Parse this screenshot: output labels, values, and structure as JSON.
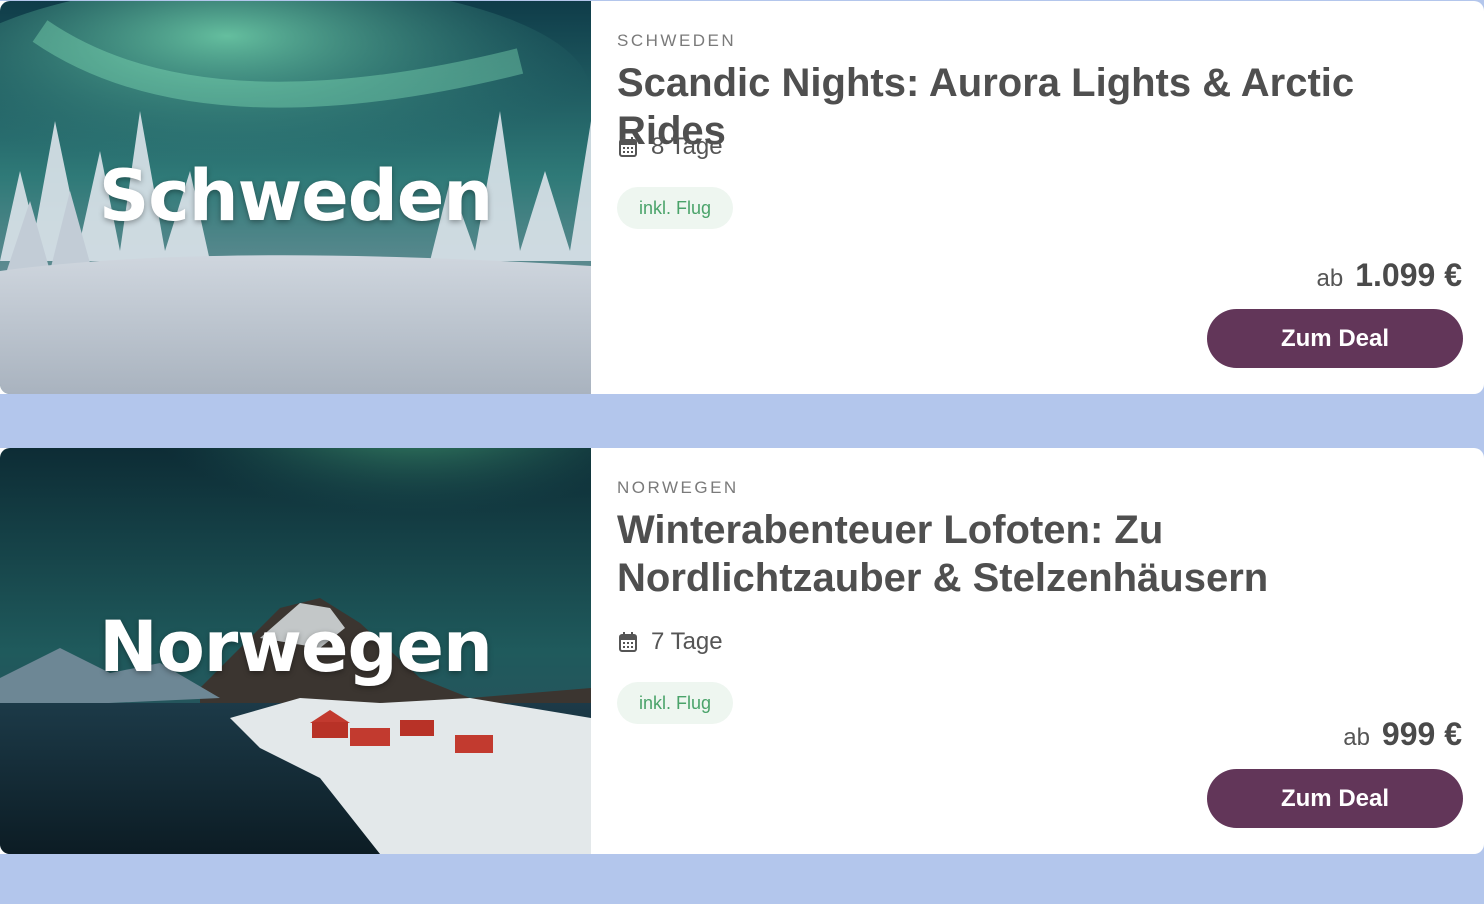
{
  "colors": {
    "page_background": "#b3c6ec",
    "button": "#623659",
    "badge_background": "#eef6f0",
    "badge_text": "#4aa36a"
  },
  "deals": [
    {
      "image_title": "Schweden",
      "country_label": "SCHWEDEN",
      "title": "Scandic Nights: Aurora Lights & Arctic Rides",
      "duration": "8 Tage",
      "badge": "inkl. Flug",
      "price_prefix": "ab",
      "price": "1.099 €",
      "button_label": "Zum Deal",
      "icon": "calendar-icon"
    },
    {
      "image_title": "Norwegen",
      "country_label": "NORWEGEN",
      "title": "Winterabenteuer Lofoten: Zu Nordlichtzauber & Stelzenhäusern",
      "duration": "7 Tage",
      "badge": "inkl. Flug",
      "price_prefix": "ab",
      "price": "999 €",
      "button_label": "Zum Deal",
      "icon": "calendar-icon"
    }
  ]
}
